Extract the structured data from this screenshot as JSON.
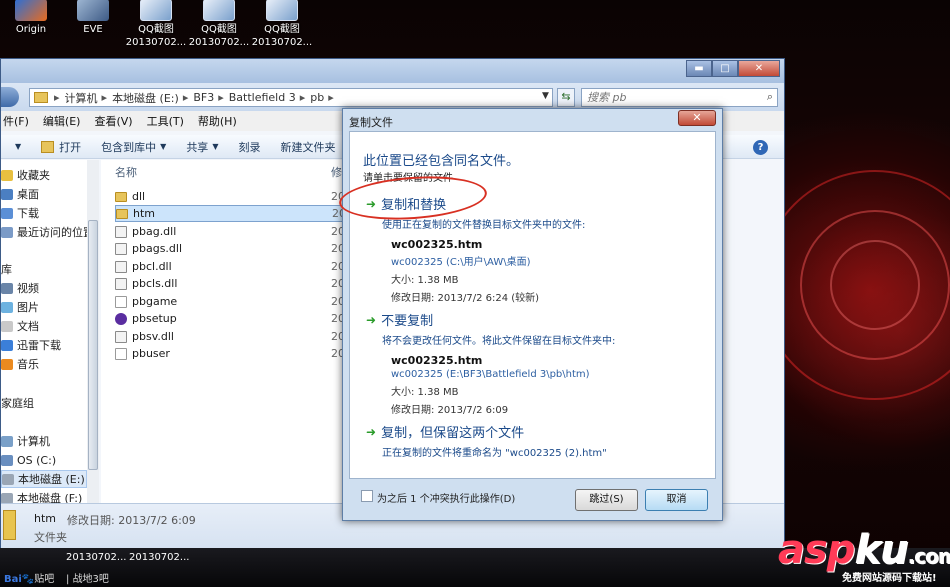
{
  "desktop": {
    "icons": [
      {
        "label1": "Origin",
        "label2": "",
        "icon": "origin-icon"
      },
      {
        "label1": "EVE",
        "label2": "",
        "icon": "eve-icon"
      },
      {
        "label1": "QQ截图",
        "label2": "20130702...",
        "icon": "qq-screenshot-icon"
      },
      {
        "label1": "QQ截图",
        "label2": "20130702...",
        "icon": "qq-screenshot-icon"
      },
      {
        "label1": "QQ截图",
        "label2": "20130702...",
        "icon": "qq-screenshot-icon"
      }
    ]
  },
  "explorer": {
    "breadcrumbs": [
      "计算机",
      "本地磁盘 (E:)",
      "BF3",
      "Battlefield 3",
      "pb"
    ],
    "search_placeholder": "搜索 pb",
    "menu": [
      "件(F)",
      "编辑(E)",
      "查看(V)",
      "工具(T)",
      "帮助(H)"
    ],
    "toolbar": {
      "open": "打开",
      "include": "包含到库中",
      "share": "共享",
      "burn": "刻录",
      "new_folder": "新建文件夹"
    },
    "nav": {
      "favorites": "收藏夹",
      "desktop": "桌面",
      "downloads": "下载",
      "recent": "最近访问的位置",
      "libraries": "库",
      "videos": "视频",
      "pictures": "图片",
      "documents": "文档",
      "xunlei": "迅雷下载",
      "music": "音乐",
      "homegroup": "家庭组",
      "computer": "计算机",
      "os_c": "OS (C:)",
      "disk_e": "本地磁盘 (E:)",
      "disk_f": "本地磁盘 (F:)"
    },
    "columns": {
      "name": "名称",
      "date": "修"
    },
    "files": [
      {
        "name": "dll",
        "type": "folder",
        "date": "20"
      },
      {
        "name": "htm",
        "type": "folder",
        "date": "20"
      },
      {
        "name": "pbag.dll",
        "type": "dll",
        "date": "20"
      },
      {
        "name": "pbags.dll",
        "type": "dll",
        "date": "20"
      },
      {
        "name": "pbcl.dll",
        "type": "dll",
        "date": "20"
      },
      {
        "name": "pbcls.dll",
        "type": "dll",
        "date": "20"
      },
      {
        "name": "pbgame",
        "type": "blank",
        "date": "20"
      },
      {
        "name": "pbsetup",
        "type": "exe",
        "date": "20"
      },
      {
        "name": "pbsv.dll",
        "type": "dll",
        "date": "20"
      },
      {
        "name": "pbuser",
        "type": "blank",
        "date": "20"
      }
    ],
    "details": {
      "name": "htm",
      "meta": "修改日期: 2013/7/2 6:09",
      "type": "文件夹"
    }
  },
  "dialog": {
    "title": "复制文件",
    "heading": "此位置已经包含同名文件。",
    "subheading": "请单击要保留的文件",
    "option_replace": {
      "title": "复制和替换",
      "desc": "使用正在复制的文件替换目标文件夹中的文件:",
      "file": "wc002325.htm",
      "path": "wc002325 (C:\\用户\\AW\\桌面)",
      "size": "大小: 1.38 MB",
      "date": "修改日期: 2013/7/2 6:24 (较新)"
    },
    "option_skip": {
      "title": "不要复制",
      "desc": "将不会更改任何文件。将此文件保留在目标文件夹中:",
      "file": "wc002325.htm",
      "path": "wc002325 (E:\\BF3\\Battlefield 3\\pb\\htm)",
      "size": "大小: 1.38 MB",
      "date": "修改日期: 2013/7/2 6:09"
    },
    "option_keep_both": {
      "title": "复制，但保留这两个文件",
      "desc": "正在复制的文件将重命名为 \"wc002325 (2).htm\""
    },
    "checkbox_label": "为之后 1 个冲突执行此操作(D)",
    "skip_button": "跳过(S)",
    "cancel_button": "取消"
  },
  "taskbar": {
    "thumbs": [
      "20130702...",
      "20130702..."
    ],
    "baidu_logo": "Bai",
    "baidu_rest": "贴吧",
    "forum": "战地3吧"
  },
  "watermark": {
    "asp": "asp",
    "ku": "ku",
    "dotcom": ".com",
    "subtitle": "免费网站源码下载站!"
  }
}
